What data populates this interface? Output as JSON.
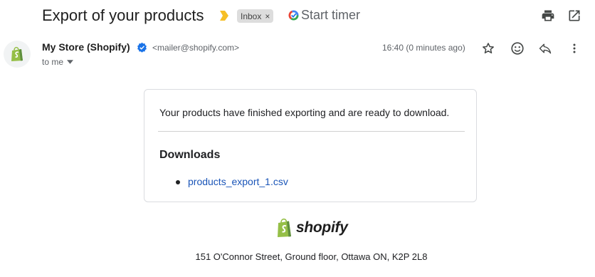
{
  "email": {
    "subject": "Export of your products",
    "label": "Inbox",
    "label_remove": "×",
    "timer_label": "Start timer",
    "sender_name": "My Store (Shopify)",
    "sender_email": "<mailer@shopify.com>",
    "time": "16:40 (0 minutes ago)",
    "recipient": "to me"
  },
  "icons": {
    "importance": "importance-marker-icon",
    "timer": "timer-icon",
    "print": "print-icon",
    "popout": "open-in-new-window-icon",
    "verified": "verified-badge-icon",
    "star": "star-icon",
    "emoji": "emoji-reaction-icon",
    "reply": "reply-icon",
    "more": "more-vert-icon",
    "avatar": "shopify-bag-icon"
  },
  "body": {
    "message": "Your products have finished exporting and are ready to download.",
    "downloads_heading": "Downloads",
    "download_link": "products_export_1.csv"
  },
  "footer": {
    "brand": "shopify",
    "address": "151 O'Connor Street, Ground floor, Ottawa ON, K2P 2L8"
  },
  "colors": {
    "link": "#1a55b8",
    "shopify_green": "#95bf47",
    "verified_blue": "#1a73e8",
    "importance_yellow": "#f6bf26"
  }
}
